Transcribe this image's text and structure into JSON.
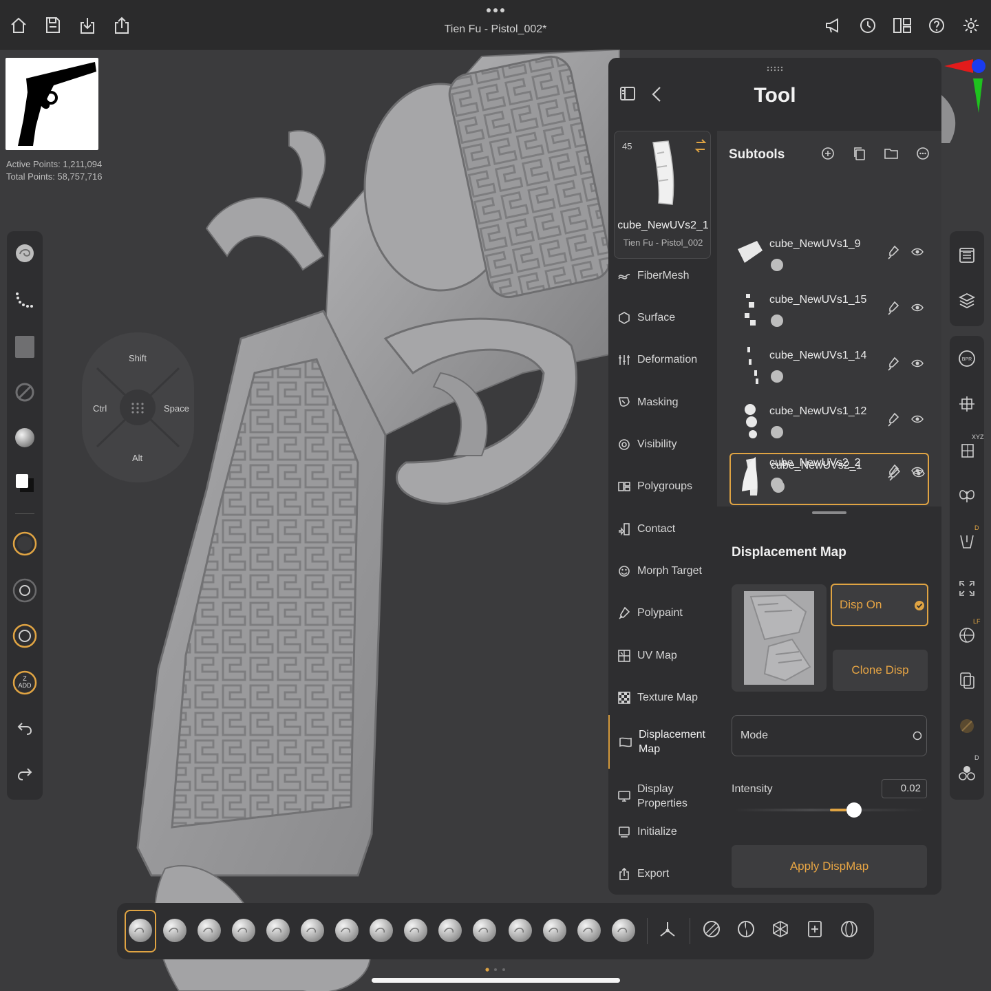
{
  "top_bar": {
    "title": "Tien Fu - Pistol_002*",
    "left_icons": [
      "home-icon",
      "save-icon",
      "import-icon",
      "export-share-icon"
    ],
    "right_icons": [
      "announce-icon",
      "history-icon",
      "layout-icon",
      "help-icon",
      "settings-icon"
    ]
  },
  "stats": {
    "active_points": "Active Points: 1,211,094",
    "total_points": "Total Points: 58,757,716"
  },
  "pie_menu": {
    "top": "Shift",
    "left": "Ctrl",
    "right": "Space",
    "bottom": "Alt"
  },
  "left_bar": {
    "z_add_line1": "Z",
    "z_add_line2": "ADD"
  },
  "tool_panel": {
    "title": "Tool",
    "current_tool": {
      "count": "45",
      "name": "cube_NewUVs2_1",
      "project": "Tien Fu - Pistol_002"
    },
    "menu": [
      {
        "label": "FiberMesh",
        "icon": "fibermesh-icon"
      },
      {
        "label": "Surface",
        "icon": "surface-icon"
      },
      {
        "label": "Deformation",
        "icon": "deformation-icon"
      },
      {
        "label": "Masking",
        "icon": "masking-icon"
      },
      {
        "label": "Visibility",
        "icon": "visibility-icon"
      },
      {
        "label": "Polygroups",
        "icon": "polygroups-icon"
      },
      {
        "label": "Contact",
        "icon": "contact-icon"
      },
      {
        "label": "Morph Target",
        "icon": "morph-target-icon"
      },
      {
        "label": "Polypaint",
        "icon": "polypaint-icon"
      },
      {
        "label": "UV Map",
        "icon": "uv-map-icon"
      },
      {
        "label": "Texture Map",
        "icon": "texture-map-icon"
      },
      {
        "label": "Displacement Map",
        "icon": "displacement-map-icon",
        "active": true
      },
      {
        "label": "Display Properties",
        "icon": "display-properties-icon"
      },
      {
        "label": "Initialize",
        "icon": "initialize-icon"
      },
      {
        "label": "Export",
        "icon": "export-icon"
      }
    ],
    "subtools": {
      "heading": "Subtools",
      "items": [
        {
          "name": "cube_NewUVs1_9"
        },
        {
          "name": "cube_NewUVs1_15"
        },
        {
          "name": "cube_NewUVs1_14"
        },
        {
          "name": "cube_NewUVs1_12"
        },
        {
          "name": "cube_NewUVs2_1",
          "selected": true
        },
        {
          "name": "cube_NewUVs2_2"
        }
      ]
    },
    "displacement": {
      "heading": "Displacement Map",
      "disp_on": "Disp On",
      "clone_disp": "Clone Disp",
      "mode_label": "Mode",
      "intensity_label": "Intensity",
      "intensity_value": "0.02",
      "intensity_fraction": 0.3,
      "apply": "Apply DispMap"
    }
  },
  "right_bar": {
    "xyz_label": "XYZ",
    "d_label": "D",
    "lf_label": "LF",
    "d2_label": "D"
  },
  "colors": {
    "accent": "#e0a443",
    "panel": "#2e2e30",
    "background": "#3b3b3d"
  }
}
